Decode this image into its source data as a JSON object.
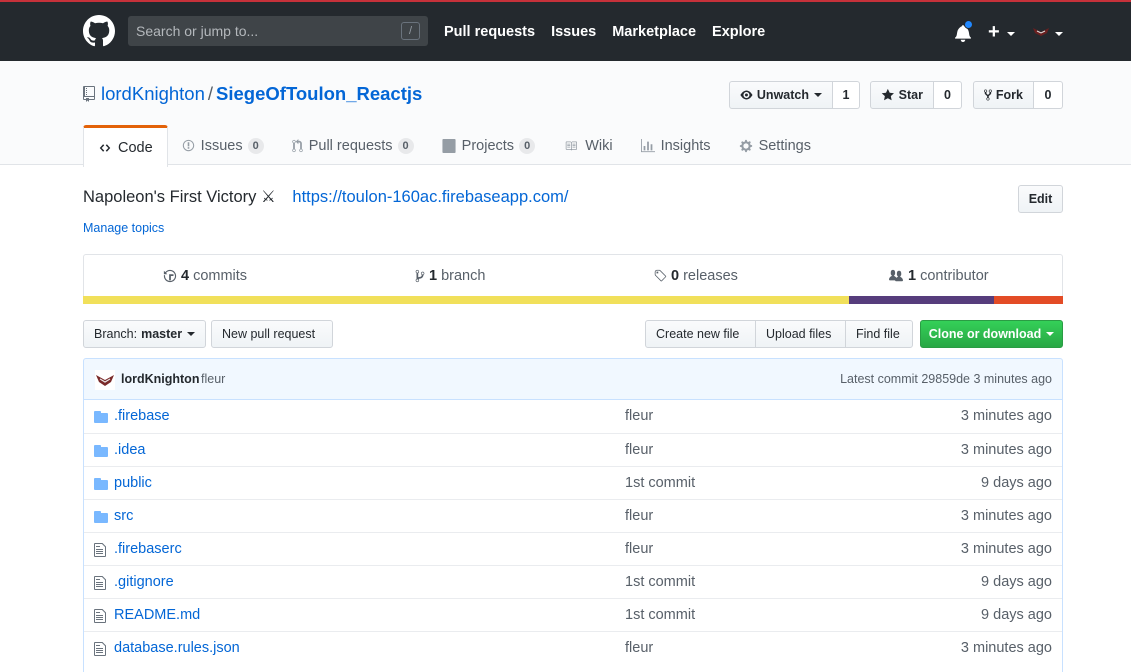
{
  "header": {
    "search_placeholder": "Search or jump to...",
    "search_shortcut": "/",
    "nav": [
      "Pull requests",
      "Issues",
      "Marketplace",
      "Explore"
    ],
    "plus_label": "+"
  },
  "repo": {
    "owner": "lordKnighton",
    "separator": "/",
    "name": "SiegeOfToulon_Reactjs",
    "watch": {
      "label": "Unwatch",
      "count": "1"
    },
    "star": {
      "label": "Star",
      "count": "0"
    },
    "fork": {
      "label": "Fork",
      "count": "0"
    }
  },
  "tabs": [
    {
      "label": "Code",
      "badge": "",
      "icon": "code-icon",
      "selected": true
    },
    {
      "label": "Issues",
      "badge": "0",
      "icon": "issue-icon"
    },
    {
      "label": "Pull requests",
      "badge": "0",
      "icon": "pull-request-icon"
    },
    {
      "label": "Projects",
      "badge": "0",
      "icon": "project-icon"
    },
    {
      "label": "Wiki",
      "badge": "",
      "icon": "book-icon"
    },
    {
      "label": "Insights",
      "badge": "",
      "icon": "graph-icon"
    },
    {
      "label": "Settings",
      "badge": "",
      "icon": "gear-icon"
    }
  ],
  "about": {
    "description": "Napoleon's First Victory ⚔",
    "url": "https://toulon-160ac.firebaseapp.com/",
    "edit_label": "Edit",
    "manage_topics": "Manage topics"
  },
  "summary": {
    "commits_count": "4",
    "commits_label": "commits",
    "branch_count": "1",
    "branch_label": "branch",
    "releases_count": "0",
    "releases_label": "releases",
    "contributor_count": "1",
    "contributor_label": "contributor",
    "languages": [
      {
        "color": "#f1e05a",
        "percent": 78.2
      },
      {
        "color": "#563d7c",
        "percent": 14.8
      },
      {
        "color": "#e34c26",
        "percent": 7.0
      }
    ]
  },
  "file_nav": {
    "branch_prefix": "Branch:",
    "branch_name": "master",
    "new_pr": "New pull request",
    "create_file": "Create new file",
    "upload_files": "Upload files",
    "find_file": "Find file",
    "clone": "Clone or download"
  },
  "latest_commit": {
    "author": "lordKnighton",
    "message": "fleur",
    "info": "Latest commit 29859de 3 minutes ago"
  },
  "files": [
    {
      "type": "dir",
      "name": ".firebase",
      "message": "fleur",
      "age": "3 minutes ago"
    },
    {
      "type": "dir",
      "name": ".idea",
      "message": "fleur",
      "age": "3 minutes ago"
    },
    {
      "type": "dir",
      "name": "public",
      "message": "1st commit",
      "age": "9 days ago"
    },
    {
      "type": "dir",
      "name": "src",
      "message": "fleur",
      "age": "3 minutes ago"
    },
    {
      "type": "file",
      "name": ".firebaserc",
      "message": "fleur",
      "age": "3 minutes ago"
    },
    {
      "type": "file",
      "name": ".gitignore",
      "message": "1st commit",
      "age": "9 days ago"
    },
    {
      "type": "file",
      "name": "README.md",
      "message": "1st commit",
      "age": "9 days ago"
    },
    {
      "type": "file",
      "name": "database.rules.json",
      "message": "fleur",
      "age": "3 minutes ago"
    }
  ]
}
